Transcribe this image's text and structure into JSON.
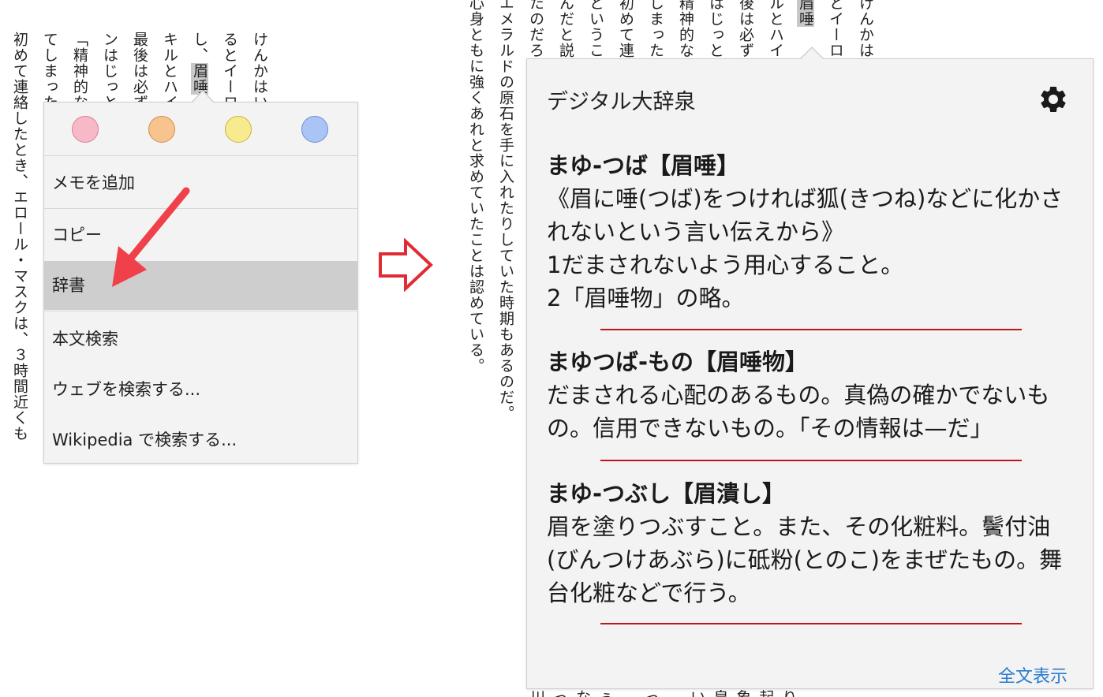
{
  "book_left": {
    "columns": [
      "けんかはい",
      "るとイーロン親",
      "し、眉唾ものの合",
      "キルとハイテ、",
      "最後は必ずな",
      "ンはじっとば",
      "「精神的なか、",
      "てしまった。",
      "初めて連絡したとき、エロール・マスクは、３時間近くも"
    ],
    "highlight": "眉唾"
  },
  "book_right": {
    "columns": [
      "けんかは",
      "とイーロ",
      "眉唾",
      "ルとハイ",
      "後は必ず",
      "はじっと",
      "精神的な",
      "しまった",
      "初めて連",
      "ということ",
      "んだと説",
      "たのだろ",
      "エメラルドの原石を手に入れたりしていた時期もあるのだ。",
      "心身ともに強くあれと求めていたことは認めている。"
    ],
    "bottom_row": "川 っ な ぅ 　 っ 　 い 皇 象 起 り"
  },
  "context_menu": {
    "colors": [
      "#f7b9c8",
      "#f7c38f",
      "#f7ea8f",
      "#a9c4f5"
    ],
    "color_borders": [
      "#d87f95",
      "#d88e4e",
      "#c9b444",
      "#6e8fd0"
    ],
    "items": [
      "メモを追加",
      "コピー",
      "辞書",
      "本文検索",
      "ウェブを検索する...",
      "Wikipedia で検索する..."
    ],
    "selected": "辞書"
  },
  "dictionary": {
    "title": "デジタル大辞泉",
    "entries": [
      {
        "head": "まゆ-つば【眉唾】",
        "lines": [
          "《眉に唾(つば)をつければ狐(きつね)などに化かさ",
          "れないという言い伝えから》",
          "1だまされないよう用心すること。",
          "2「眉唾物」の略。"
        ]
      },
      {
        "head": "まゆつば-もの【眉唾物】",
        "lines": [
          "だまされる心配のあるもの。真偽の確かでないも",
          "の。信用できないもの。「その情報は—だ」"
        ]
      },
      {
        "head": "まゆ-つぶし【眉潰し】",
        "lines": [
          "眉を塗りつぶすこと。また、その化粧料。鬢付油",
          "(びんつけあぶら)に砥粉(とのこ)をまぜたもの。舞",
          "台化粧などで行う。"
        ]
      }
    ],
    "full_text_link": "全文表示",
    "accent": "#c0151b",
    "link_color": "#2a7bd1"
  }
}
